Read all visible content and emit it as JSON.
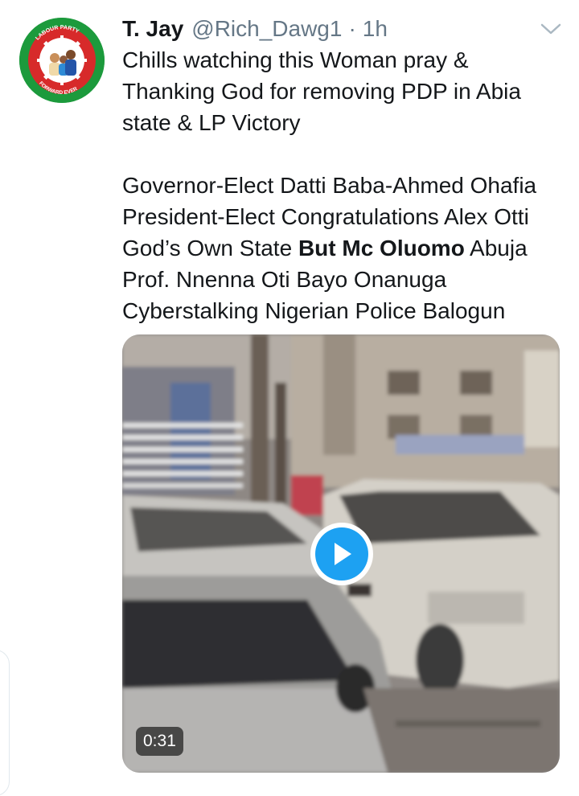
{
  "tweet": {
    "display_name": "T. Jay",
    "handle": "@Rich_Dawg1",
    "separator": "·",
    "time": "1h",
    "avatar_text_top": "LABOUR PARTY",
    "avatar_text_bottom": "FORWARD EVER",
    "body_line1": "Chills watching this Woman pray & Thanking God for removing PDP in Abia state & LP Victory",
    "body_line2_part1": "Governor-Elect Datti Baba-Ahmed Ohafia President-Elect Congratulations Alex Otti God’s Own State ",
    "body_line2_bold": "But Mc Oluomo",
    "body_line2_part2": " Abuja Prof. Nnenna Oti Bayo Onanuga Cyberstalking Nigerian Police Balogun"
  },
  "media": {
    "type": "video",
    "duration": "0:31",
    "play_icon": "play-icon"
  },
  "colors": {
    "accent": "#1da1f2",
    "text": "#14171a",
    "secondary": "#657786",
    "avatar_green": "#1c9a3c",
    "avatar_red": "#d72a2a"
  }
}
